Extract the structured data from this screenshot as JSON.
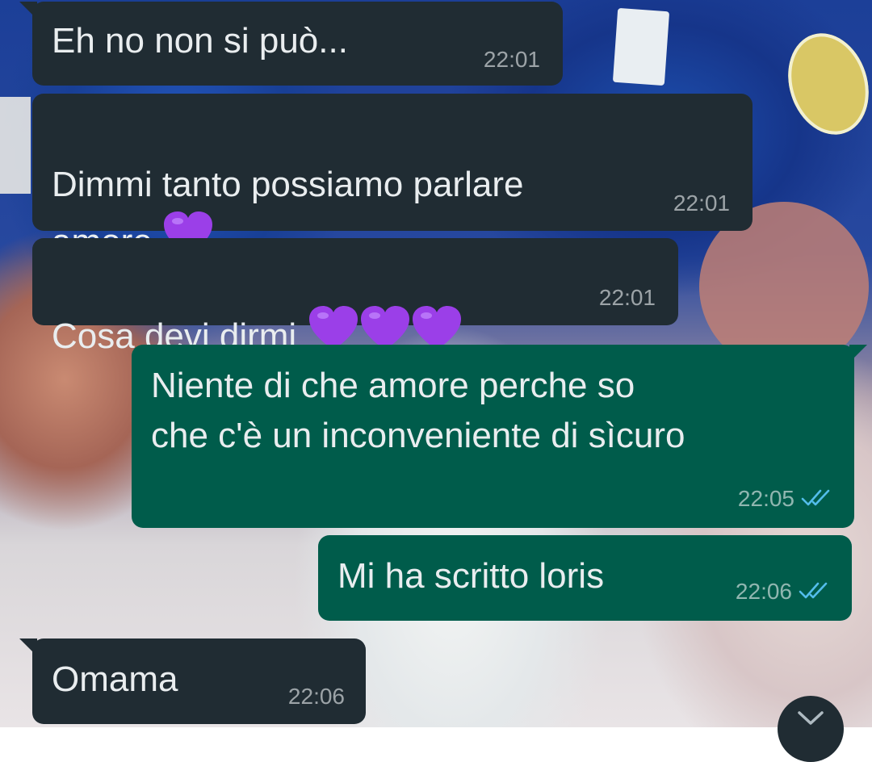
{
  "colors": {
    "incoming_bubble": "#202c33",
    "outgoing_bubble": "#005c4b",
    "text": "#e9edef",
    "read_ticks": "#53bdeb"
  },
  "messages": [
    {
      "direction": "incoming",
      "text": "Eh no non si può...",
      "time": "22:01"
    },
    {
      "direction": "incoming",
      "text": "Dimmi tanto possiamo parlare\namore",
      "emoji": "purple-heart",
      "emoji_count": 1,
      "time": "22:01"
    },
    {
      "direction": "incoming",
      "text": "Cosa devi dirmi",
      "emoji": "purple-heart",
      "emoji_count": 3,
      "time": "22:01"
    },
    {
      "direction": "outgoing",
      "text": "Niente di che amore perche so\nche c'è un inconveniente di sìcuro",
      "time": "22:05",
      "status": "read"
    },
    {
      "direction": "outgoing",
      "text": "Mi ha scritto loris",
      "time": "22:06",
      "status": "read"
    },
    {
      "direction": "incoming",
      "text": "Omama",
      "time": "22:06"
    }
  ],
  "scroll_button": {
    "icon": "chevron-down-icon"
  }
}
